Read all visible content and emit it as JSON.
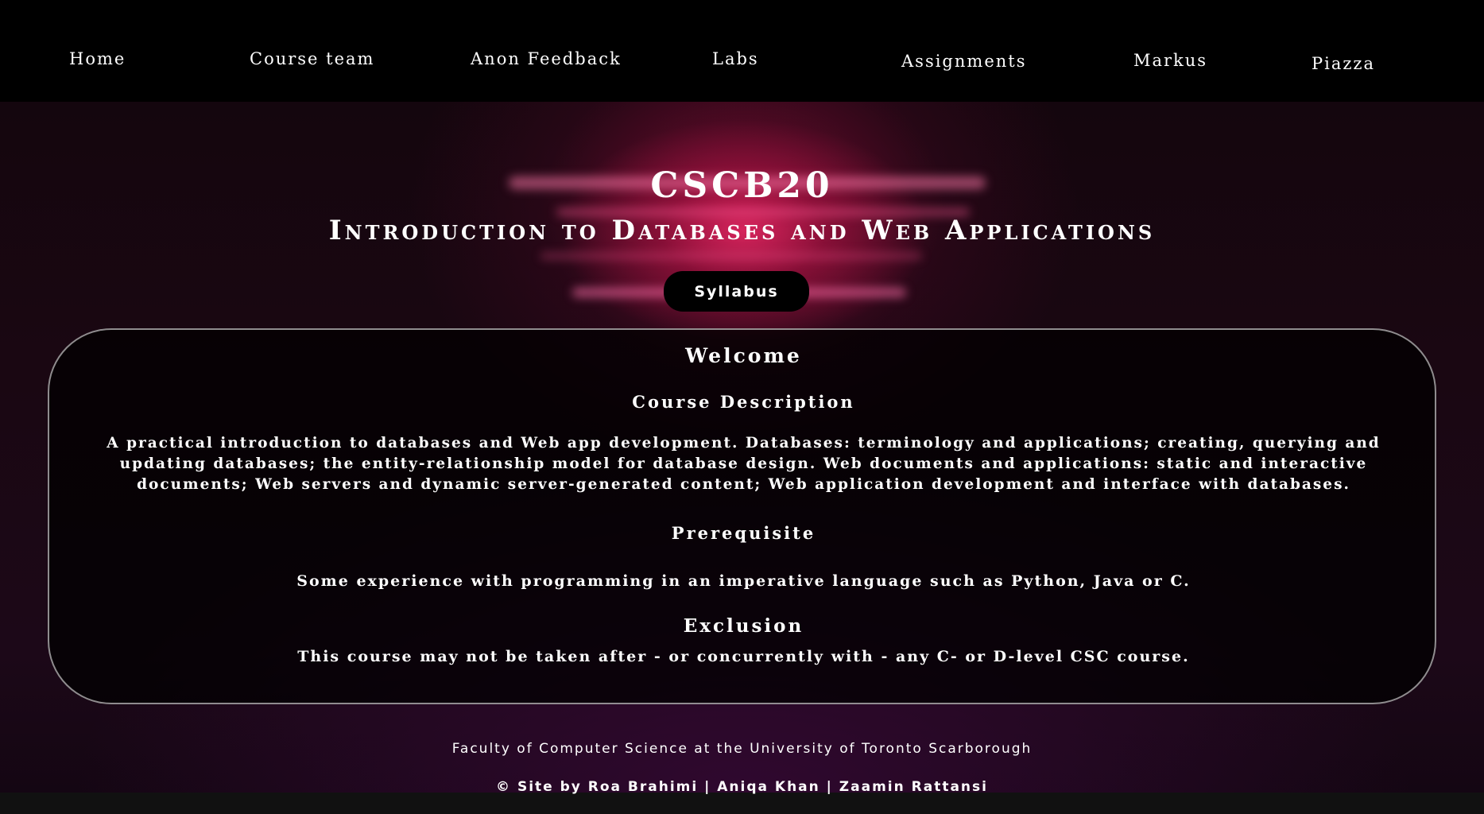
{
  "nav": {
    "items": [
      {
        "label": "Home"
      },
      {
        "label": "Course team"
      },
      {
        "label": "Anon Feedback"
      },
      {
        "label": "Labs"
      },
      {
        "label": "Assignments"
      },
      {
        "label": "Markus"
      },
      {
        "label": "Piazza"
      }
    ]
  },
  "hero": {
    "title": "CSCB20",
    "subtitle": "Introduction to Databases and Web Applications",
    "syllabus_label": "Syllabus"
  },
  "welcome": {
    "heading": "Welcome",
    "description_heading": "Course Description",
    "description": "A practical introduction to databases and Web app development. Databases: terminology and applications; creating, querying and updating databases; the entity-relationship model for database design. Web documents and applications: static and interactive documents; Web servers and dynamic server-generated content; Web application development and interface with databases.",
    "prerequisite_heading": "Prerequisite",
    "prerequisite": "Some experience with programming in an imperative language such as Python, Java or C.",
    "exclusion_heading": "Exclusion",
    "exclusion": "This course may not be taken after - or concurrently with - any C- or D-level CSC course."
  },
  "footer": {
    "faculty": "Faculty of Computer Science at the University of Toronto Scarborough",
    "credits": "© Site by Roa Brahimi | Aniqa Khan | Zaamin Rattansi"
  },
  "colors": {
    "nav_bg": "#000000",
    "accent": "#e8286a",
    "text": "#ffffff"
  }
}
